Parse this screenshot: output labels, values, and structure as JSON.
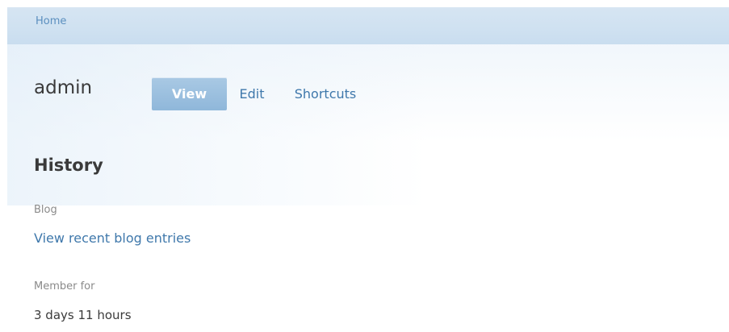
{
  "breadcrumb": {
    "home_label": "Home"
  },
  "header": {
    "title": "admin"
  },
  "tabs": [
    {
      "label": "View",
      "active": true
    },
    {
      "label": "Edit",
      "active": false
    },
    {
      "label": "Shortcuts",
      "active": false
    }
  ],
  "history": {
    "heading": "History",
    "blog_label": "Blog",
    "blog_link": "View recent blog entries",
    "member_label": "Member for",
    "member_value": "3 days 11 hours"
  },
  "colors": {
    "accent": "#3f78ab",
    "tab_active_bg": "#9fc2e1",
    "breadcrumb_bg": "#d0e2f1",
    "text": "#3a3a3a",
    "muted": "#8a8a8a"
  }
}
